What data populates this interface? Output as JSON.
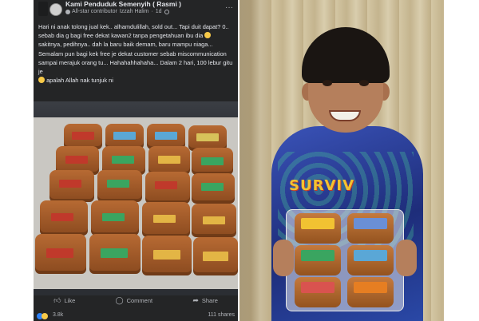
{
  "post": {
    "group_name": "Kami Penduduk Semenyih ( Rasmi )",
    "badge": "All-star contributor",
    "author": "Izzah Halim",
    "time": "1d",
    "separator": "·",
    "more": "···",
    "text": "Hari ni anak tolong jual kek.. alhamdulillah, sold out... Tapi duit dapat? 0.. sebab dia g bagi free dekat kawan2 tanpa pengetahuan ibu dia",
    "text_cont": "sakitnya, pedihnya.. dah la baru baik demam, baru mampu niaga... Semalam pun bagi kek free je dekat customer sebab miscommunication sampai merajuk orang tu... Hahahahhahaha... Dalam 2 hari, 100 lebur gitu je",
    "text_end": "apalah Allah nak tunjuk ni",
    "like_label": "Like",
    "comment_label": "Comment",
    "share_label": "Share",
    "reaction_count": "3.8k",
    "shares": "111 shares"
  },
  "photo_right": {
    "shirt_text": "SURVIV"
  },
  "colors": {
    "facebook_dark": "#242526",
    "text_primary": "#e4e6eb",
    "text_secondary": "#b0b3b8",
    "like_blue": "#2e81f7",
    "haha_yellow": "#f7c948"
  }
}
